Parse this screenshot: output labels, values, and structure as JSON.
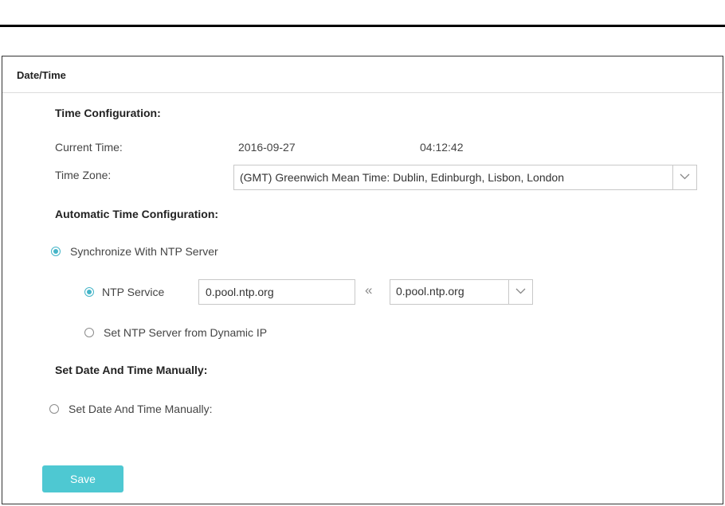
{
  "panel": {
    "title": "Date/Time"
  },
  "time_config": {
    "heading": "Time Configuration:",
    "current_time_label": "Current Time:",
    "current_date": "2016-09-27",
    "current_time": "04:12:42",
    "time_zone_label": "Time Zone:",
    "time_zone_value": "(GMT) Greenwich Mean Time: Dublin, Edinburgh, Lisbon, London"
  },
  "auto_config": {
    "heading": "Automatic Time Configuration:",
    "sync_ntp_label": "Synchronize With NTP Server",
    "sync_ntp_checked": true,
    "ntp_service_label": "NTP Service",
    "ntp_service_checked": true,
    "ntp_input_value": "0.pool.ntp.org",
    "ntp_select_value": "0.pool.ntp.org",
    "copy_icon": "double-chevron-left-icon",
    "dynamic_ip_label": "Set NTP Server from Dynamic IP",
    "dynamic_ip_checked": false
  },
  "manual_config": {
    "heading": "Set Date And Time Manually:",
    "manual_radio_label": "Set Date And Time Manually:",
    "manual_checked": false
  },
  "actions": {
    "save_label": "Save"
  },
  "colors": {
    "accent": "#45b5c8",
    "save_button": "#4ec8d2",
    "border": "#c8c8c8"
  }
}
